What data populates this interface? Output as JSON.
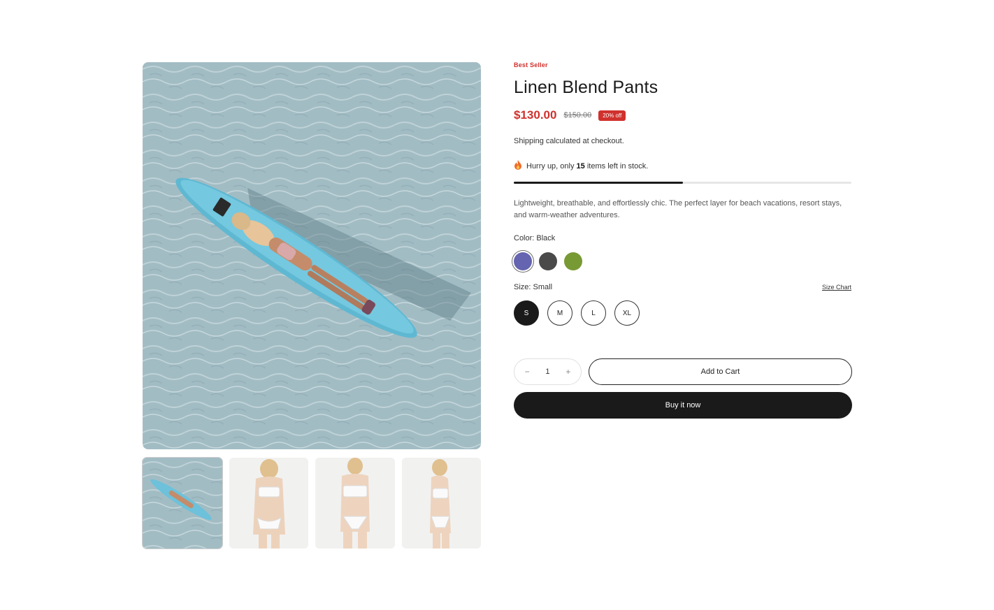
{
  "product": {
    "badge": "Best Seller",
    "title": "Linen Blend Pants",
    "price": "$130.00",
    "compare_price": "$150.00",
    "discount": "20% off",
    "shipping": "Shipping calculated at checkout.",
    "stock": {
      "prefix": "Hurry up, only",
      "count": "15",
      "suffix": "items left in stock.",
      "level": 0.5
    },
    "description": "Lightweight, breathable, and effortlessly chic. The perfect layer for beach vacations, resort stays, and warm-weather adventures."
  },
  "color": {
    "label": "Color: Black",
    "swatches": [
      {
        "name": "purple",
        "hex": "#6464b0"
      },
      {
        "name": "charcoal",
        "hex": "#4a4a4a"
      },
      {
        "name": "olive",
        "hex": "#789a34"
      }
    ]
  },
  "size": {
    "label": "Size: Small",
    "chart_link": "Size Chart",
    "options": [
      "S",
      "M",
      "L",
      "XL"
    ],
    "selected": "S"
  },
  "cart": {
    "minus": "−",
    "quantity": "1",
    "plus": "+",
    "add_label": "Add to Cart",
    "buy_label": "Buy it now"
  },
  "colors": {
    "accent": "#d0312d",
    "dark": "#1a1a1a"
  }
}
